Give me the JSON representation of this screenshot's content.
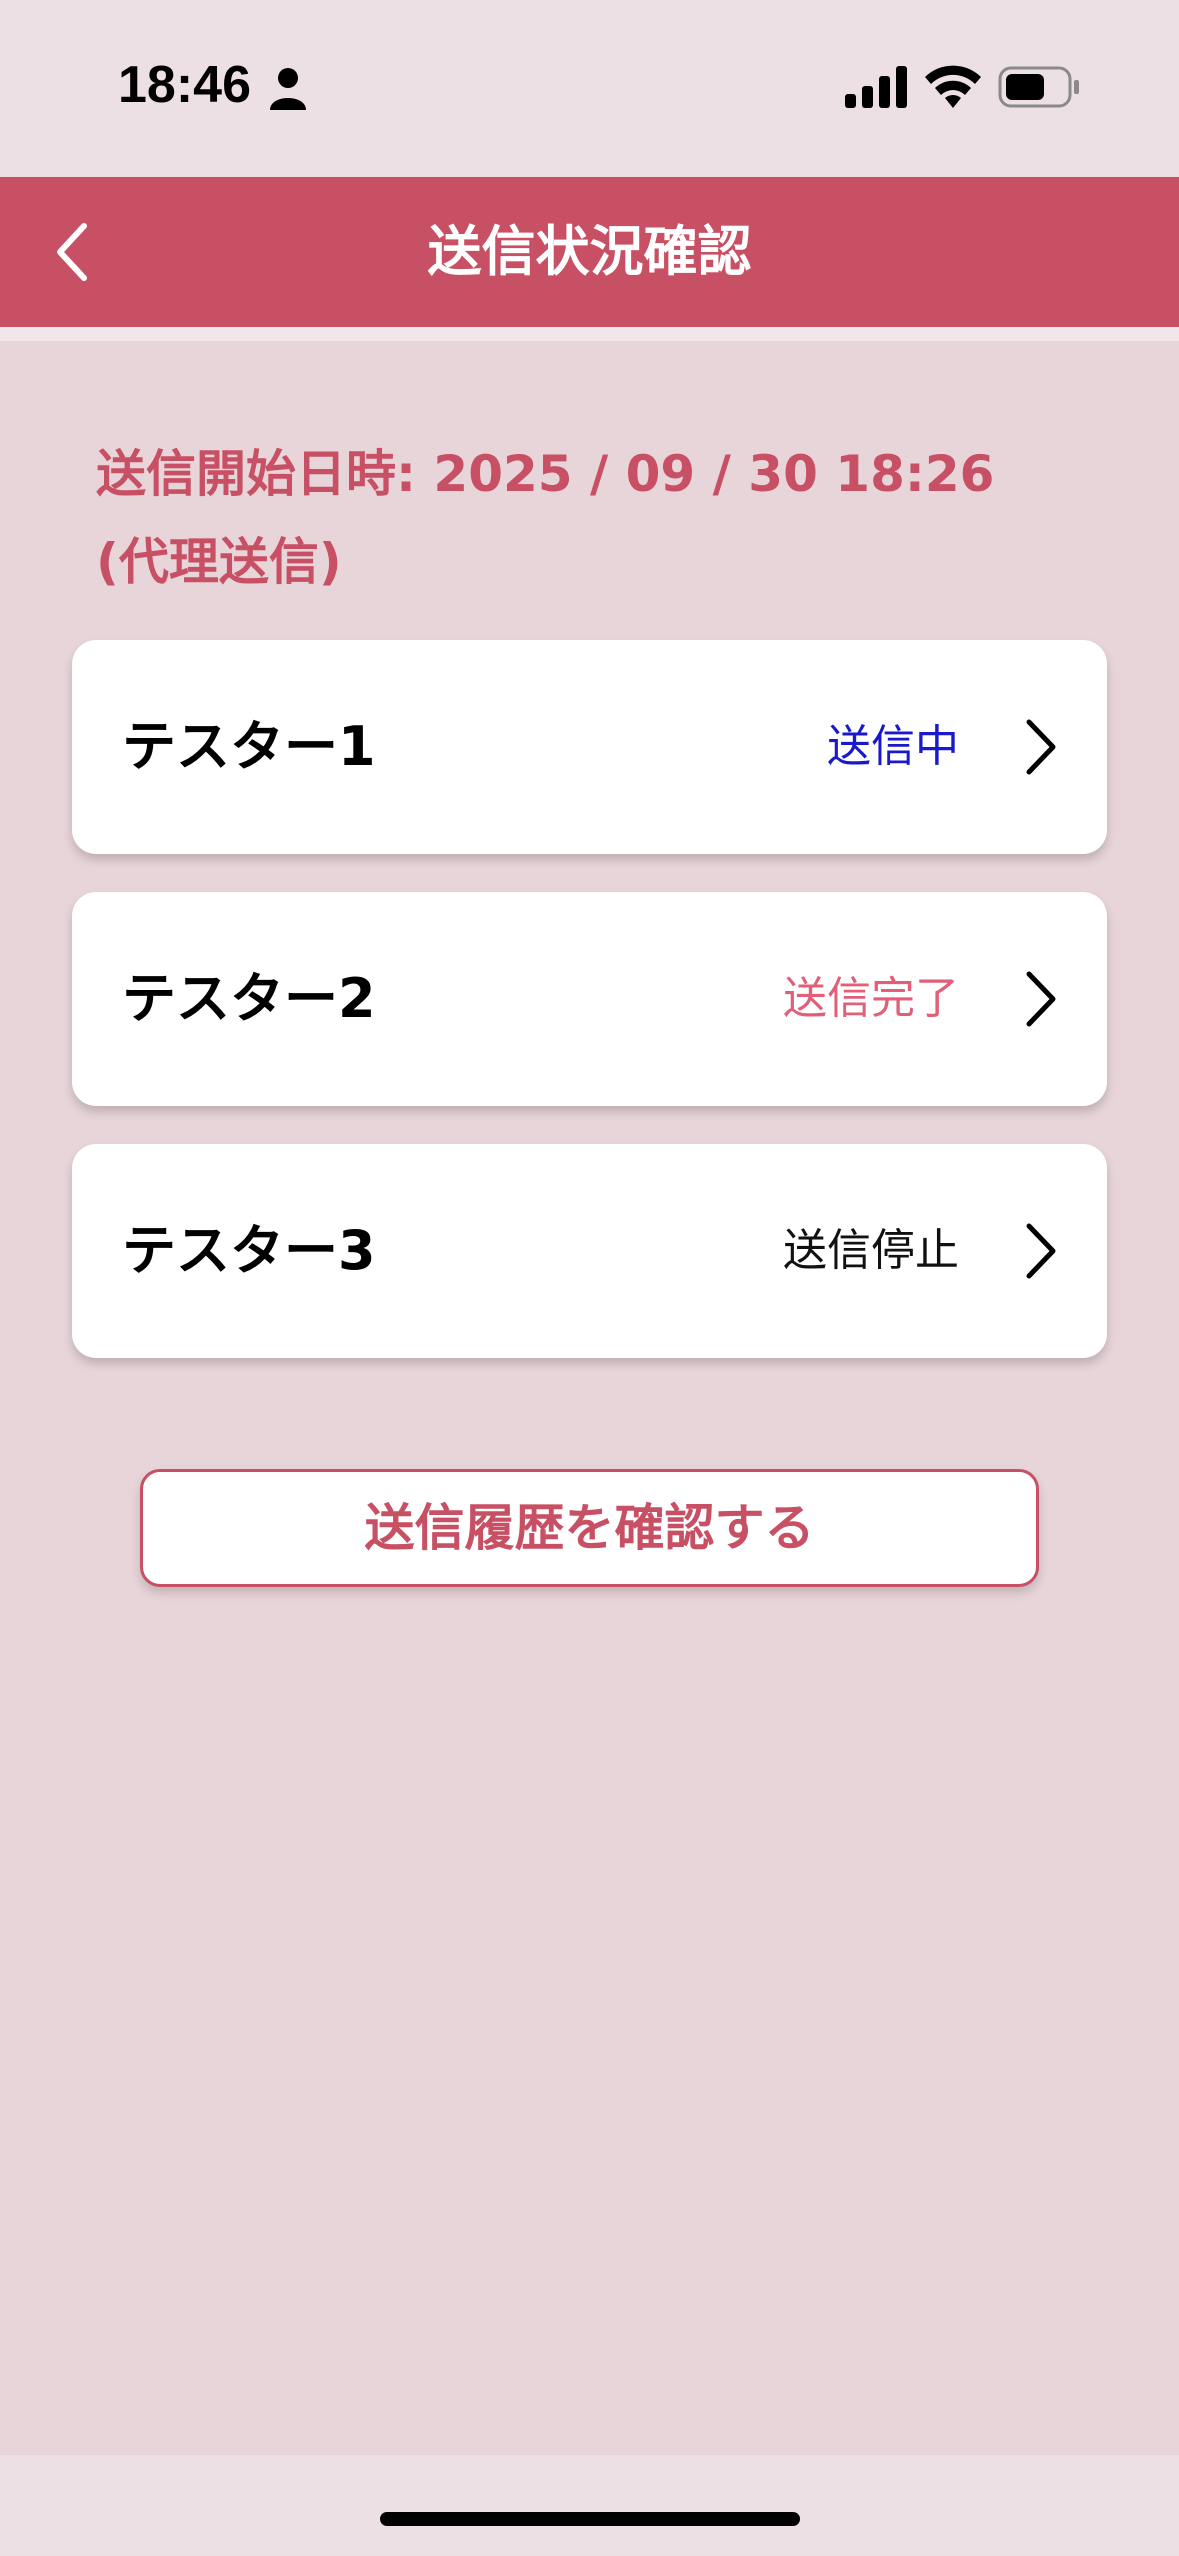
{
  "status_bar": {
    "time": "18:46"
  },
  "header": {
    "title": "送信状況確認",
    "back_icon": "chevron-left-icon"
  },
  "start_info": {
    "datetime": "送信開始日時: 2025 / 09 / 30  18:26",
    "note": "(代理送信)"
  },
  "recipients": [
    {
      "name": "テスター1",
      "status": "送信中",
      "status_color": "#1a1acc"
    },
    {
      "name": "テスター2",
      "status": "送信完了",
      "status_color": "#e0607a"
    },
    {
      "name": "テスター3",
      "status": "送信停止",
      "status_color": "#111111"
    }
  ],
  "history_button": {
    "label": "送信履歴を確認する"
  },
  "colors": {
    "accent": "#c85064",
    "background": "#e8d5d9"
  }
}
